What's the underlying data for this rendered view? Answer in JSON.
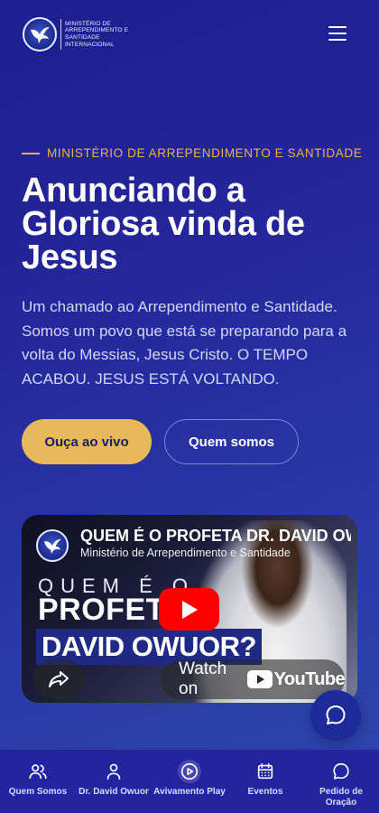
{
  "header": {
    "logo_text": "MINISTÉRIO DE ARREPENDIMENTO E SANTIDADE INTERNACIONAL",
    "logo_icon": "dove-emblem-icon",
    "menu_icon": "hamburger-menu-icon"
  },
  "hero": {
    "eyebrow": "MINISTÉRIO DE ARREPENDIMENTO E SANTIDADE",
    "title": "Anunciando a Gloriosa vinda de Jesus",
    "description": "Um chamado ao Arrependimento e Santidade. Somos um povo que está se preparando para a volta do Messias, Jesus Cristo. O TEMPO ACABOU. JESUS ESTÁ VOLTANDO.",
    "primary_button": "Ouça ao vivo",
    "secondary_button": "Quem somos"
  },
  "video": {
    "title": "QUEM É O PROFETA DR. DAVID OWUOR?",
    "channel": "Ministério de Arrependimento e Santidade",
    "thumb_line1": "QUEM É O",
    "thumb_line2": "PROFETA",
    "thumb_line3": "DAVID OWUOR?",
    "watch_label": "Watch on",
    "youtube_label": "YouTube",
    "share_icon": "share-arrow-icon",
    "play_icon": "play-icon"
  },
  "chat": {
    "icon": "chat-bubble-icon"
  },
  "bottom_nav": {
    "items": [
      {
        "label": "Quem Somos",
        "icon": "users-icon",
        "active": false
      },
      {
        "label": "Dr. David Owuor",
        "icon": "user-icon",
        "active": false
      },
      {
        "label": "Avivamento Play",
        "icon": "play-circle-icon",
        "active": true
      },
      {
        "label": "Eventos",
        "icon": "calendar-icon",
        "active": false
      },
      {
        "label": "Pedido de Oração",
        "icon": "message-circle-icon",
        "active": false
      }
    ]
  },
  "colors": {
    "accent": "#e8b24f",
    "button_primary": "#e8b95a",
    "background": "#24279a",
    "nav_background": "#2324a0",
    "youtube_red": "#ff0000"
  }
}
